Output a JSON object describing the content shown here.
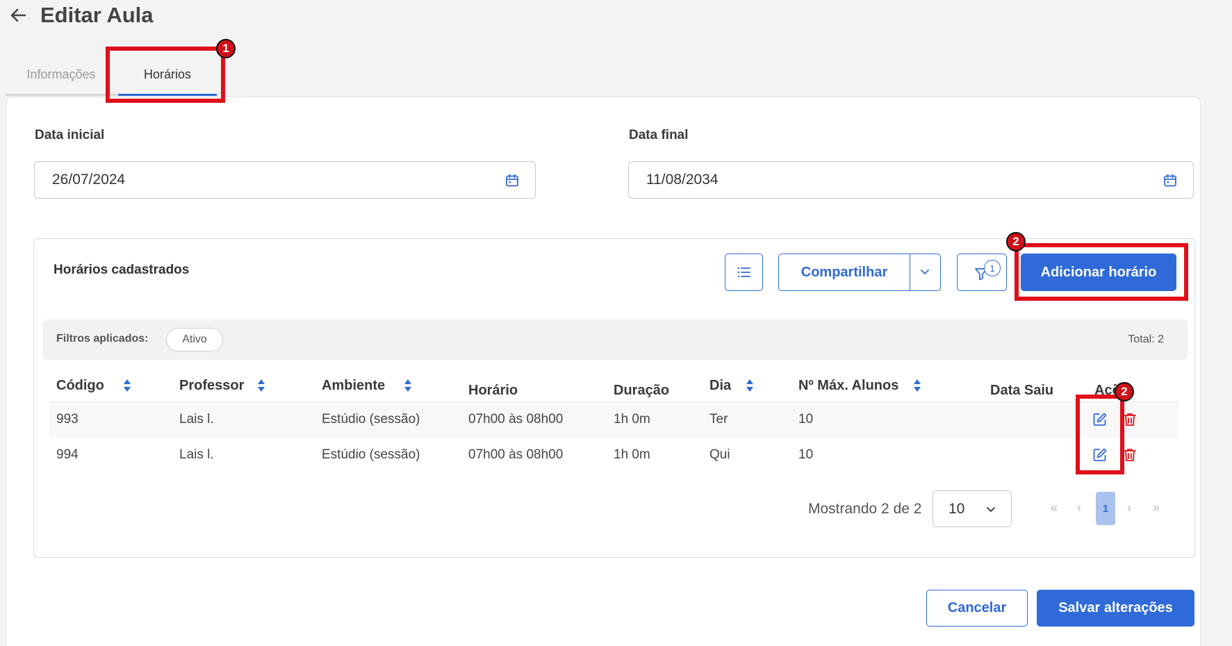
{
  "header": {
    "title": "Editar Aula"
  },
  "tabs": [
    {
      "label": "Informações"
    },
    {
      "label": "Horários"
    }
  ],
  "form": {
    "start_label": "Data inicial",
    "start_value": "26/07/2024",
    "end_label": "Data final",
    "end_value": "11/08/2034"
  },
  "schedules": {
    "title": "Horários cadastrados",
    "share_label": "Compartilhar",
    "filter_count": "1",
    "add_label": "Adicionar horário",
    "filters_label": "Filtros aplicados:",
    "filter_chip": "Ativo",
    "total": "Total: 2",
    "columns": [
      "Código",
      "Professor",
      "Ambiente",
      "Horário",
      "Duração",
      "Dia",
      "Nº Máx. Alunos",
      "Data Saiu",
      "Ações"
    ],
    "rows": [
      {
        "codigo": "993",
        "professor": "Lais l.",
        "ambiente": "Estúdio (sessão)",
        "horario": "07h00 às 08h00",
        "duracao": "1h 0m",
        "dia": "Ter",
        "max": "10",
        "saiu": ""
      },
      {
        "codigo": "994",
        "professor": "Lais l.",
        "ambiente": "Estúdio (sessão)",
        "horario": "07h00 às 08h00",
        "duracao": "1h 0m",
        "dia": "Qui",
        "max": "10",
        "saiu": ""
      }
    ]
  },
  "pagination": {
    "showing": "Mostrando 2 de 2",
    "page_size": "10",
    "current_page": "1",
    "first": "«",
    "prev": "‹",
    "next": "›",
    "last": "»"
  },
  "footer": {
    "cancel_label": "Cancelar",
    "save_label": "Salvar alterações"
  },
  "annotations": [
    "1",
    "2",
    "2"
  ],
  "colors": {
    "primary": "#2f6ad8",
    "danger": "#e0101a",
    "annotation": "#e0101a"
  }
}
